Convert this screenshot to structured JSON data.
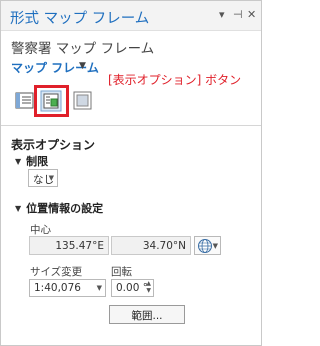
{
  "pane": {
    "title": "形式 マップ フレーム",
    "controls": {
      "menu": "▾",
      "pin": "⊣",
      "close": "✕"
    },
    "element_name": "警察署 マップ フレーム",
    "dropdown_label": "マップ フレーム",
    "annotation": "[表示オプション] ボタン"
  },
  "tools": [
    {
      "name": "options-tab-properties",
      "icon": "properties-icon"
    },
    {
      "name": "options-tab-display",
      "icon": "display-options-icon",
      "highlighted": true
    },
    {
      "name": "options-tab-placement",
      "icon": "placement-icon"
    }
  ],
  "display_options": {
    "title": "表示オプション",
    "constraint": {
      "header": "制限",
      "value": "なし"
    },
    "location": {
      "header": "位置情報の設定",
      "center_label": "中心",
      "center_x": "135.47°E",
      "center_y": "34.70°N",
      "scale_label": "サイズ変更",
      "scale_value": "1:40,076",
      "rotation_label": "回転",
      "rotation_value": "0.00 °",
      "extent_button": "範囲..."
    }
  },
  "colors": {
    "accent": "#1f6fbf",
    "annotation": "#e0202a"
  }
}
